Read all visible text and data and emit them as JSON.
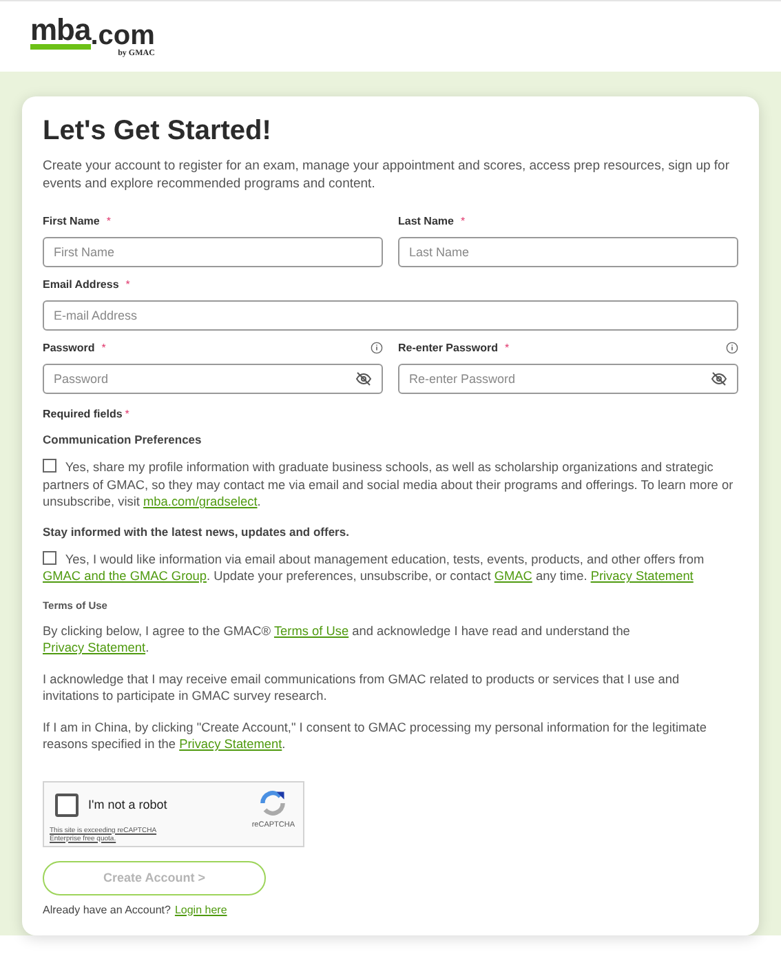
{
  "header": {
    "logo": {
      "main": "mba",
      "suffix": ".com",
      "byline": "by GMAC"
    }
  },
  "form": {
    "title": "Let's Get Started!",
    "intro": "Create your account to register for an exam, manage your appointment and scores, access prep resources, sign up for events and explore recommended programs and content.",
    "field_rows": [
      [
        {
          "label": "First Name",
          "required_mark": "*",
          "placeholder": "First Name",
          "kind": "text",
          "info": false
        },
        {
          "label": "Last Name",
          "required_mark": "*",
          "placeholder": "Last Name",
          "kind": "text",
          "info": false
        }
      ],
      [
        {
          "label": "Email Address",
          "required_mark": "*",
          "placeholder": "E-mail Address",
          "kind": "text",
          "info": false
        }
      ],
      [
        {
          "label": "Password",
          "required_mark": "*",
          "placeholder": "Password",
          "kind": "password",
          "info": true
        },
        {
          "label": "Re-enter Password",
          "required_mark": "*",
          "placeholder": "Re-enter Password",
          "kind": "password",
          "info": true
        }
      ]
    ],
    "required_note": {
      "text": "Required fields",
      "mark": "*"
    },
    "preferences": [
      {
        "heading": "Communication Preferences",
        "checked": false,
        "parts": [
          {
            "text": "Yes, share my profile information with graduate business schools, as well as scholarship organizations and strategic partners of GMAC, so they may contact me via email and social media about their programs and offerings. To learn more or unsubscribe, visit ",
            "link": false
          },
          {
            "text": "mba.com/gradselect",
            "link": true
          },
          {
            "text": ".",
            "link": false
          }
        ]
      },
      {
        "heading": "Stay informed with the latest news, updates and offers.",
        "checked": false,
        "parts": [
          {
            "text": "Yes, I would like information via email about management education, tests, events, products, and other offers from ",
            "link": false
          },
          {
            "text": "GMAC and the GMAC Group",
            "link": true
          },
          {
            "text": ". Update your preferences, unsubscribe, or contact ",
            "link": false
          },
          {
            "text": "GMAC",
            "link": true
          },
          {
            "text": " any time. ",
            "link": false
          },
          {
            "text": "Privacy Statement",
            "link": true
          }
        ]
      }
    ],
    "terms": {
      "heading": "Terms of Use",
      "paragraphs": [
        [
          {
            "text": "By clicking below, I agree to the GMAC® ",
            "link": false
          },
          {
            "text": "Terms of Use",
            "link": true
          },
          {
            "text": " and acknowledge I have read and understand the ",
            "link": false
          },
          {
            "text": "Privacy Statement",
            "link": true
          },
          {
            "text": ".",
            "link": false
          }
        ],
        [
          {
            "text": "I acknowledge that I may receive email communications from GMAC related to products or services that I use and invitations to participate in GMAC survey research.",
            "link": false
          }
        ],
        [
          {
            "text": "If I am in China, by clicking \"Create Account,\" I consent to GMAC processing my personal information for the legitimate reasons specified in the ",
            "link": false
          },
          {
            "text": "Privacy Statement",
            "link": true
          },
          {
            "text": ".",
            "link": false
          }
        ]
      ]
    },
    "captcha": {
      "label": "I'm not a robot",
      "checked": false,
      "notice": "This site is exceeding reCAPTCHA Enterprise free quota.",
      "brand": "reCAPTCHA"
    },
    "submit": {
      "label": "Create Account >",
      "disabled": true
    },
    "login": {
      "text": "Already have an Account?",
      "link": "Login here"
    }
  }
}
